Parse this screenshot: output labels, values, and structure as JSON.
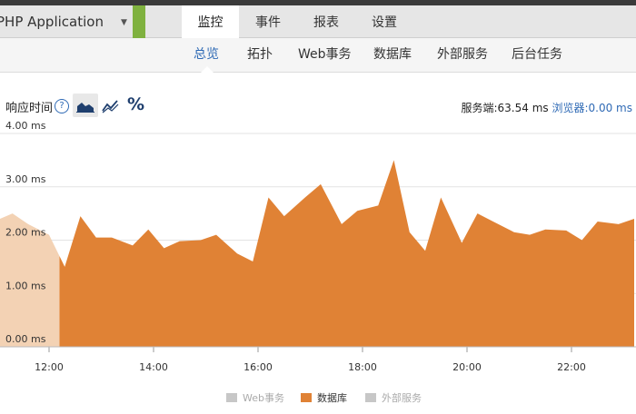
{
  "header": {
    "app_name": "PHP Application",
    "tabs": [
      {
        "label": "监控",
        "active": true
      },
      {
        "label": "事件",
        "active": false
      },
      {
        "label": "报表",
        "active": false
      },
      {
        "label": "设置",
        "active": false
      }
    ]
  },
  "subnav": {
    "items": [
      {
        "label": "总览",
        "active": true
      },
      {
        "label": "拓扑",
        "active": false
      },
      {
        "label": "Web事务",
        "active": false
      },
      {
        "label": "数据库",
        "active": false
      },
      {
        "label": "外部服务",
        "active": false
      },
      {
        "label": "后台任务",
        "active": false
      }
    ]
  },
  "metric": {
    "title": "响应时间",
    "help": "?",
    "percent_label": "%",
    "server_label": "服务端:",
    "server_value": "63.54 ms",
    "browser_label": "浏览器:",
    "browser_value": "0.00 ms"
  },
  "colors": {
    "accent": "#2f6ab5",
    "database": "#e08235",
    "database_faded": "#f3d2b4",
    "legend_off": "#c7c7c7",
    "app_green": "#7fb13f"
  },
  "chart_data": {
    "type": "area",
    "title": "响应时间",
    "y_unit": "ms",
    "ylim": [
      0,
      4
    ],
    "y_ticks": [
      "0.00 ms",
      "1.00 ms",
      "2.00 ms",
      "3.00 ms",
      "4.00 ms"
    ],
    "x_ticks": [
      "12:00",
      "14:00",
      "16:00",
      "18:00",
      "20:00",
      "22:00"
    ],
    "grid": true,
    "legend_position": "bottom",
    "x_hours": [
      10.6,
      11.0,
      11.3,
      11.6,
      12.0,
      12.3,
      12.6,
      12.9,
      13.2,
      13.6,
      13.9,
      14.2,
      14.5,
      14.9,
      15.2,
      15.6,
      15.9,
      16.2,
      16.5,
      16.9,
      17.2,
      17.6,
      17.9,
      18.3,
      18.6,
      18.9,
      19.2,
      19.5,
      19.9,
      20.2,
      20.5,
      20.9,
      21.2,
      21.5,
      21.9,
      22.2,
      22.5,
      22.9,
      23.2
    ],
    "faded_until_hour": 12.2,
    "series": [
      {
        "name": "数据库",
        "values": [
          2.1,
          2.4,
          2.5,
          2.3,
          2.1,
          1.5,
          2.45,
          2.05,
          2.05,
          1.9,
          2.2,
          1.85,
          1.98,
          2.0,
          2.1,
          1.75,
          1.6,
          2.8,
          2.45,
          2.8,
          3.05,
          2.3,
          2.55,
          2.65,
          3.5,
          2.15,
          1.8,
          2.8,
          1.95,
          2.5,
          2.35,
          2.15,
          2.1,
          2.2,
          2.18,
          2.0,
          2.35,
          2.3,
          2.4
        ]
      }
    ],
    "legend": [
      {
        "label": "Web事务",
        "active": false
      },
      {
        "label": "数据库",
        "active": true
      },
      {
        "label": "外部服务",
        "active": false
      }
    ]
  }
}
